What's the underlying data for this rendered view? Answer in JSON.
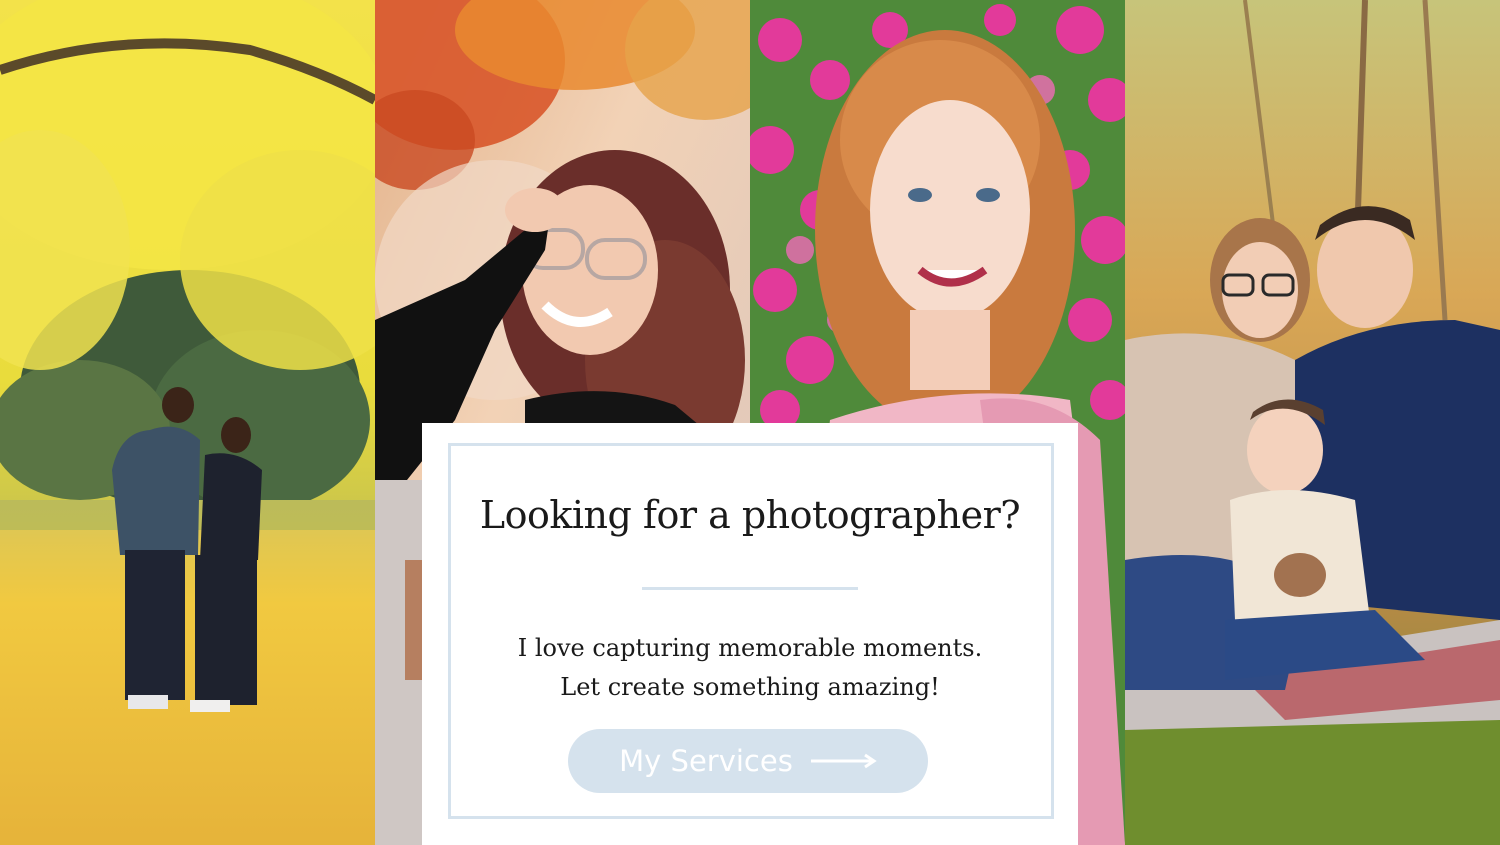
{
  "photos": [
    {
      "name": "couple-yellow-tree-photo",
      "subject": "couple under yellow ginkgo tree"
    },
    {
      "name": "woman-glasses-autumn-photo",
      "subject": "woman with glasses under autumn leaves"
    },
    {
      "name": "redhead-flowers-photo",
      "subject": "red-haired woman in front of pink flowers"
    },
    {
      "name": "family-picnic-photo",
      "subject": "family with toddler on picnic blanket"
    }
  ],
  "card": {
    "headline": "Looking for a photographer?",
    "body_line_1": "I love capturing memorable moments.",
    "body_line_2": "Let create something amazing!",
    "cta_label": "My Services",
    "cta_icon": "arrow-right-icon"
  },
  "colors": {
    "accent": "#d5e2ed",
    "text": "#1a1a1a",
    "cta_text": "#ffffff"
  }
}
